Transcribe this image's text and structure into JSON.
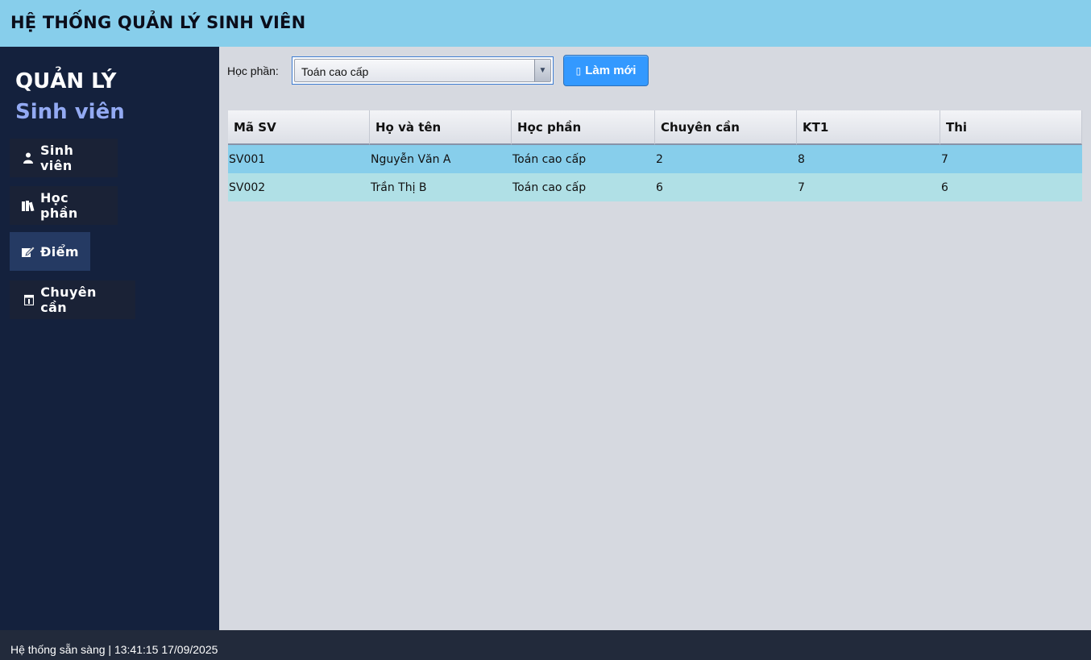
{
  "window": {
    "title": "HỆ THỐNG QUẢN LÝ SINH VIÊN"
  },
  "colors": {
    "header": "#87ceeb",
    "sidebar": "#14213d",
    "accent": "#3399ff",
    "row_selected": "#87ceeb",
    "row_alt": "#b0e0e6",
    "status_bar": "#222a3b"
  },
  "sidebar": {
    "brand_main": "QUẢN LÝ",
    "brand_sub": "Sinh viên",
    "items": [
      {
        "label": "Sinh viên",
        "icon": "person-icon"
      },
      {
        "label": "Học phần",
        "icon": "books-icon"
      },
      {
        "label": "Điểm",
        "icon": "edit-icon",
        "active": true
      },
      {
        "label": "Chuyên cần",
        "icon": "calendar-icon"
      }
    ]
  },
  "toolbar": {
    "filter_label": "Học phần:",
    "course_select": "Toán cao cấp",
    "refresh_label": "Làm mới",
    "refresh_icon": "refresh-icon"
  },
  "table": {
    "headers": [
      "Mã SV",
      "Họ và tên",
      "Học phần",
      "Chuyên cần",
      "KT1",
      "Thi"
    ],
    "rows": [
      [
        "SV001",
        "Nguyễn Văn A",
        "Toán cao cấp",
        "2",
        "8",
        "7"
      ],
      [
        "SV002",
        "Trần Thị B",
        "Toán cao cấp",
        "6",
        "7",
        "6"
      ]
    ]
  },
  "status": {
    "text": "Hệ thống sẵn sàng | 13:41:15 17/09/2025"
  }
}
